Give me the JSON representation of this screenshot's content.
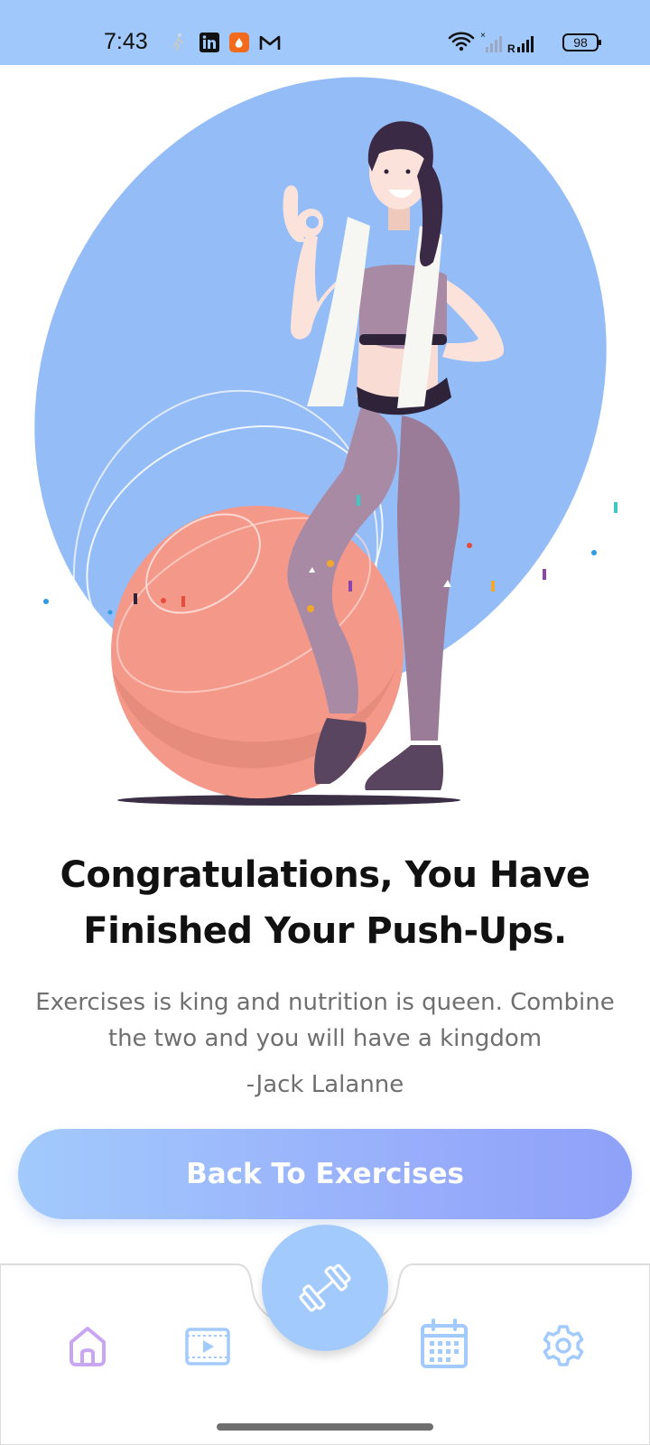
{
  "status_bar": {
    "time": "7:43",
    "battery": "98",
    "icons": [
      "walking-icon",
      "linkedin-icon",
      "app-icon",
      "gmail-icon",
      "wifi-icon",
      "signal-icon"
    ]
  },
  "content": {
    "title": "Congratulations, You Have Finished Your Push-Ups.",
    "quote": "Exercises is king and nutrition is queen. Combine the two and you will have a kingdom",
    "author": "-Jack Lalanne",
    "button_label": "Back To Exercises"
  },
  "nav": {
    "items": [
      "home-icon",
      "video-icon",
      "dumbbell-icon",
      "calendar-icon",
      "settings-icon"
    ]
  },
  "colors": {
    "status_bar": "#a0c8fb",
    "accent_blue": "#a3cafd",
    "home_purple": "#c9a6f2",
    "illustration_blue": "#94bcf7",
    "ball_salmon": "#f4998a",
    "outfit_mauve": "#a88aa5"
  }
}
